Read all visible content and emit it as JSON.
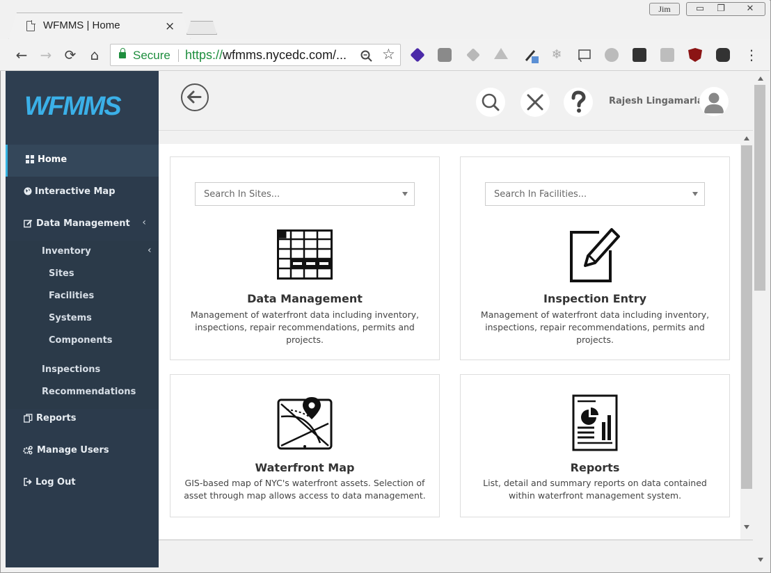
{
  "browser": {
    "tab_title": "WFMMS | Home",
    "tab_close": "×",
    "window_user": "Jim",
    "secure_label": "Secure",
    "url_scheme": "https://",
    "url_rest": "wfmms.nycedc.com/...",
    "controls": {
      "minimize": "▭",
      "restore": "❐",
      "close": "✕"
    },
    "nav": {
      "back": "←",
      "forward": "→",
      "reload": "⟳",
      "home": "⌂"
    },
    "omnibox_icons": {
      "zoom": "🔍",
      "star": "☆"
    },
    "menu": "⋮"
  },
  "app": {
    "logo": "WFMMS",
    "header": {
      "user_name": "Rajesh Lingamarla"
    },
    "sidebar": {
      "items": [
        {
          "label": "Home",
          "icon": "grid-icon"
        },
        {
          "label": "Interactive Map",
          "icon": "globe-icon"
        },
        {
          "label": "Data Management",
          "icon": "edit-icon"
        },
        {
          "label": "Reports",
          "icon": "copy-icon"
        },
        {
          "label": "Manage Users",
          "icon": "gears-icon"
        },
        {
          "label": "Log Out",
          "icon": "logout-icon"
        }
      ],
      "sub": {
        "inventory": "Inventory",
        "sites": "Sites",
        "facilities": "Facilities",
        "systems": "Systems",
        "components": "Components",
        "inspections": "Inspections",
        "recommendations": "Recommendations"
      }
    },
    "cards": [
      {
        "title": "Data Management",
        "desc": "Management of waterfront data including inventory, inspections, repair recommendations, permits and projects.",
        "select_placeholder": "Search In Sites..."
      },
      {
        "title": "Inspection Entry",
        "desc": "Management of waterfront data including inventory, inspections, repair recommendations, permits and projects.",
        "select_placeholder": "Search In Facilities..."
      },
      {
        "title": "Waterfront Map",
        "desc": "GIS-based map of NYC's waterfront assets. Selection of asset through map allows access to data management."
      },
      {
        "title": "Reports",
        "desc": "List, detail and summary reports on data contained within waterfront management system."
      }
    ],
    "colors": {
      "sidebar_bg": "#2c3b4c",
      "accent": "#35b2e0",
      "logo": "#3bb0e8",
      "secure_green": "#1e8e3e"
    }
  }
}
